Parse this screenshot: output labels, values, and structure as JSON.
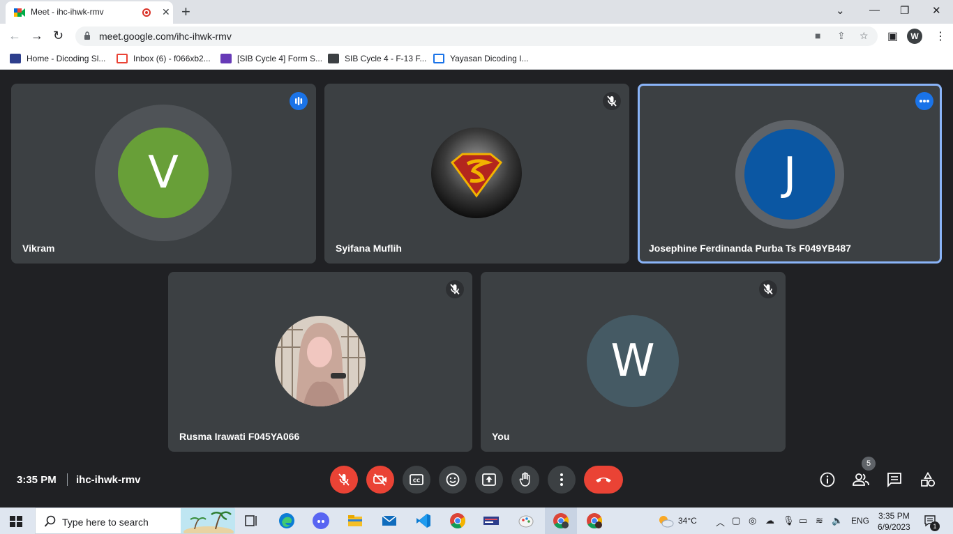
{
  "browser": {
    "tab_title": "Meet - ihc-ihwk-rmv",
    "url": "meet.google.com/ihc-ihwk-rmv",
    "profile_initial": "W",
    "bookmarks": [
      {
        "label": "Home - Dicoding Sl...",
        "icon": "dicoding-icon"
      },
      {
        "label": "Inbox (6) - f066xb2...",
        "icon": "gmail-icon"
      },
      {
        "label": "[SIB Cycle 4] Form S...",
        "icon": "forms-icon"
      },
      {
        "label": "SIB Cycle 4 - F-13 F...",
        "icon": "classroom-icon"
      },
      {
        "label": "Yayasan Dicoding I...",
        "icon": "calendar-icon"
      }
    ]
  },
  "meet": {
    "participants": [
      {
        "name": "Vikram",
        "initial": "V",
        "avatar_color": "#689f38",
        "status": "speaking"
      },
      {
        "name": "Syifana Muflih",
        "avatar": "superman-logo-photo",
        "status": "muted"
      },
      {
        "name": "Josephine Ferdinanda Purba Ts F049YB487",
        "initial": "J",
        "avatar_color": "#0b57a3",
        "status": "more-options"
      },
      {
        "name": "Rusma Irawati F045YA066",
        "avatar": "profile-photo",
        "status": "muted"
      },
      {
        "name": "You",
        "initial": "W",
        "avatar_color": "#455a64",
        "status": "muted"
      }
    ],
    "time": "3:35 PM",
    "separator": "|",
    "meeting_code": "ihc-ihwk-rmv",
    "participant_count": "5"
  },
  "taskbar": {
    "search_placeholder": "Type here to search",
    "weather": "34°C",
    "language": "ENG",
    "time": "3:35 PM",
    "date": "6/9/2023",
    "notification_count": "1"
  },
  "colors": {
    "accent": "#8ab4f8",
    "danger": "#ea4335",
    "tile_bg": "#3c4043",
    "page_bg": "#202124"
  }
}
